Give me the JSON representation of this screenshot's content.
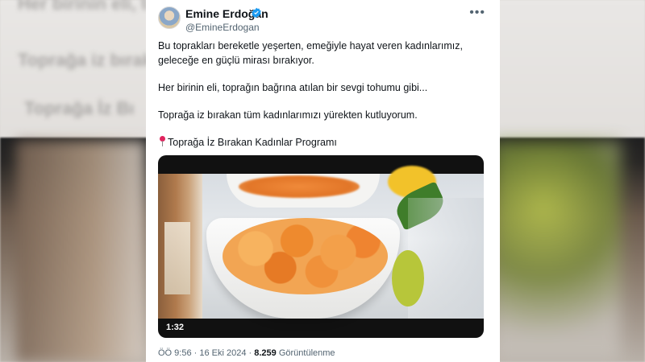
{
  "background": {
    "text_line_1": "Her birinin eli, toprağın bağrına",
    "text_line_2": "Toprağa iz bırakan",
    "text_line_3": "Toprağa İz Bı"
  },
  "tweet": {
    "author_name": "Emine Erdoğan",
    "author_handle": "@EmineErdogan",
    "more_icon": "more-horizontal-icon",
    "verified_icon": "verified-badge-icon",
    "paragraphs": [
      "Bu toprakları bereketle yeşerten, emeğiyle hayat veren kadınlarımız, geleceğe en güçlü mirası bırakıyor.",
      "Her birinin eli, toprağın bağrına atılan bir sevgi tohumu gibi...",
      "Toprağa iz bırakan tüm kadınlarımızı yürekten kutluyorum."
    ],
    "program_text": "Toprağa İz Bırakan Kadınlar Programı",
    "video_duration": "1:32",
    "timestamp": "ÖÖ 9:56 · 16 Eki 2024 · ",
    "views_count": "8.259",
    "views_label": " Görüntülenme"
  },
  "colors": {
    "verified": "#1d9bf0",
    "text_primary": "#0f1419",
    "text_secondary": "#536471"
  }
}
